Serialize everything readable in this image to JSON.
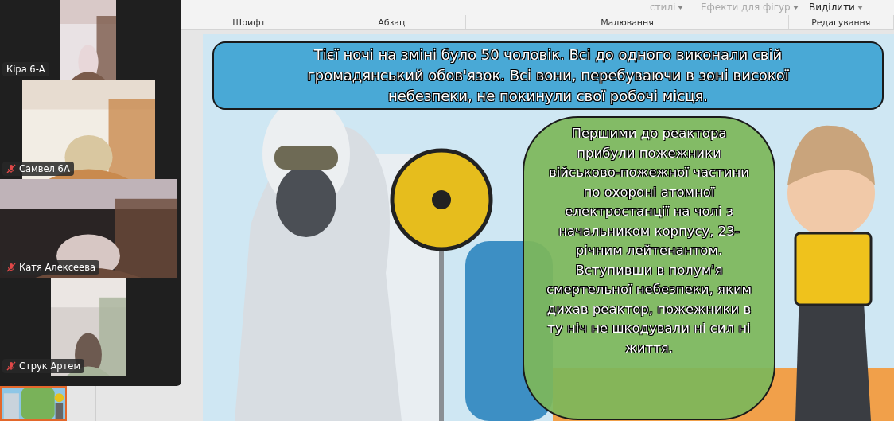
{
  "ribbon": {
    "controls": [
      {
        "label": "стилі",
        "kind": "dropdown"
      },
      {
        "label": "Ефекти для фігур",
        "kind": "effects"
      },
      {
        "label": "Виділити",
        "kind": "select"
      }
    ],
    "groups": [
      "Шрифт",
      "Абзац",
      "Малювання",
      "Редагування"
    ]
  },
  "video_panel": {
    "participants": [
      {
        "name": "Кіра 6-А",
        "muted": false
      },
      {
        "name": "Самвел 6А",
        "muted": true
      },
      {
        "name": "Катя Алексеева",
        "muted": true
      },
      {
        "name": "Струк Артем",
        "muted": true
      }
    ]
  },
  "slide": {
    "header_text": "Тієї ночі на зміні було 50 чоловік. Всі до одного виконали свій громадянський обов'язок. Всі вони, перебуваючи в зоні високої небезпеки, не покинули свої робочі місця.",
    "body_text": "Першими до реактора прибули пожежники військово-пожежної частини по охороні атомної електростанції на чолі з начальником корпусу, 23- річним лейтенантом. Вступивши в полум'я смертельної небезпеки, яким дихав реактор, пожежники в ту ніч не шкодували ні сил ні життя."
  }
}
